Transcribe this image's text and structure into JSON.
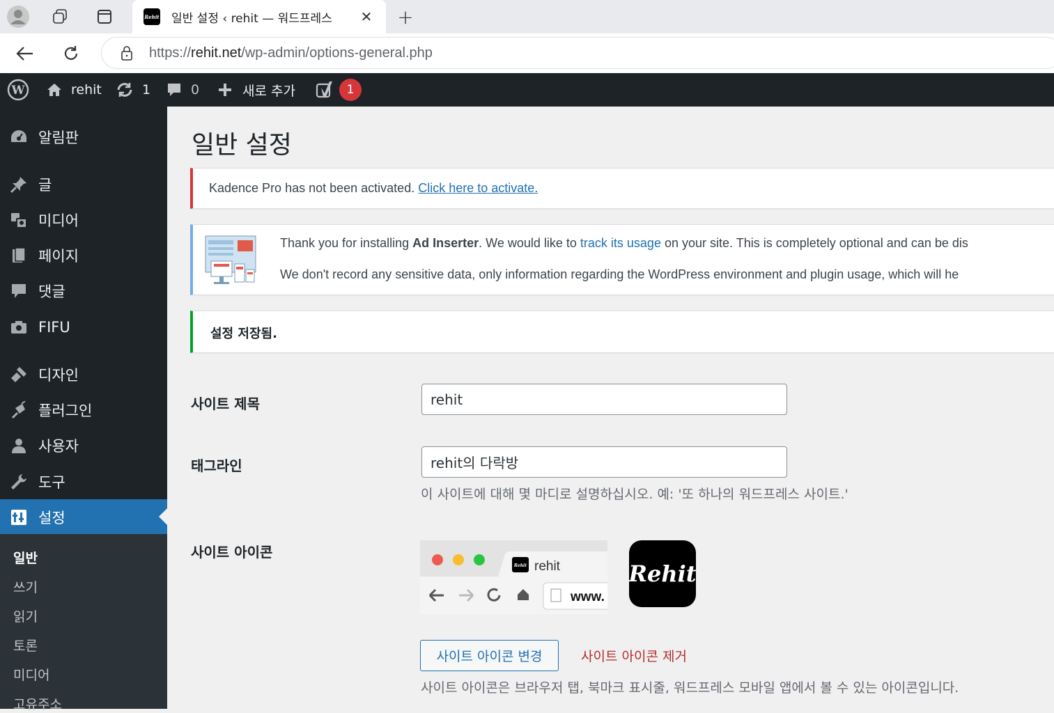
{
  "browser": {
    "tab_title": "일반 설정 ‹ rehit — 워드프레스",
    "url_prefix": "https://",
    "url_host": "rehit.net",
    "url_path": "/wp-admin/options-general.php"
  },
  "adminbar": {
    "site_name": "rehit",
    "updates_count": "1",
    "comments_count": "0",
    "new_label": "새로 추가",
    "yoast_badge": "1"
  },
  "sidebar": {
    "items": [
      {
        "label": "알림판",
        "icon": "dashboard-icon"
      },
      {
        "label": "글",
        "icon": "pin-icon"
      },
      {
        "label": "미디어",
        "icon": "media-icon"
      },
      {
        "label": "페이지",
        "icon": "page-icon"
      },
      {
        "label": "댓글",
        "icon": "comment-icon"
      },
      {
        "label": "FIFU",
        "icon": "camera-icon"
      },
      {
        "label": "디자인",
        "icon": "brush-icon"
      },
      {
        "label": "플러그인",
        "icon": "plugin-icon"
      },
      {
        "label": "사용자",
        "icon": "user-icon"
      },
      {
        "label": "도구",
        "icon": "wrench-icon"
      },
      {
        "label": "설정",
        "icon": "settings-icon"
      }
    ],
    "submenu": [
      "일반",
      "쓰기",
      "읽기",
      "토론",
      "미디어",
      "고유주소"
    ]
  },
  "main": {
    "title": "일반 설정",
    "notice_error_text": "Kadence Pro has not been activated.",
    "notice_error_link": "Click here to activate.",
    "notice_info_line1_a": "Thank you for installing",
    "notice_info_line1_b": "Ad Inserter",
    "notice_info_line1_c": ". We would like to",
    "notice_info_line1_link": "track its usage",
    "notice_info_line1_d": "on your site. This is completely optional and can be dis",
    "notice_info_line2": "We don't record any sensitive data, only information regarding the WordPress environment and plugin usage, which will he",
    "notice_success": "설정 저장됨.",
    "site_title_label": "사이트 제목",
    "site_title_value": "rehit",
    "tagline_label": "태그라인",
    "tagline_value": "rehit의 다락방",
    "tagline_desc": "이 사이트에 대해 몇 마디로 설명하십시오. 예: '또 하나의 워드프레스 사이트.'",
    "site_icon_label": "사이트 아이콘",
    "preview_tab_title": "rehit",
    "preview_url": "www.",
    "icon_text": "Rehit",
    "change_icon_button": "사이트 아이콘 변경",
    "remove_icon_link": "사이트 아이콘 제거",
    "icon_desc": "사이트 아이콘은 브라우저 탭, 북마크 표시줄, 워드프레스 모바일 앱에서 볼 수 있는 아이콘입니다. "
  },
  "colors": {
    "wp_dark": "#1d2327",
    "wp_blue": "#2271b1",
    "error_red": "#d63638",
    "success_green": "#00a32a"
  }
}
